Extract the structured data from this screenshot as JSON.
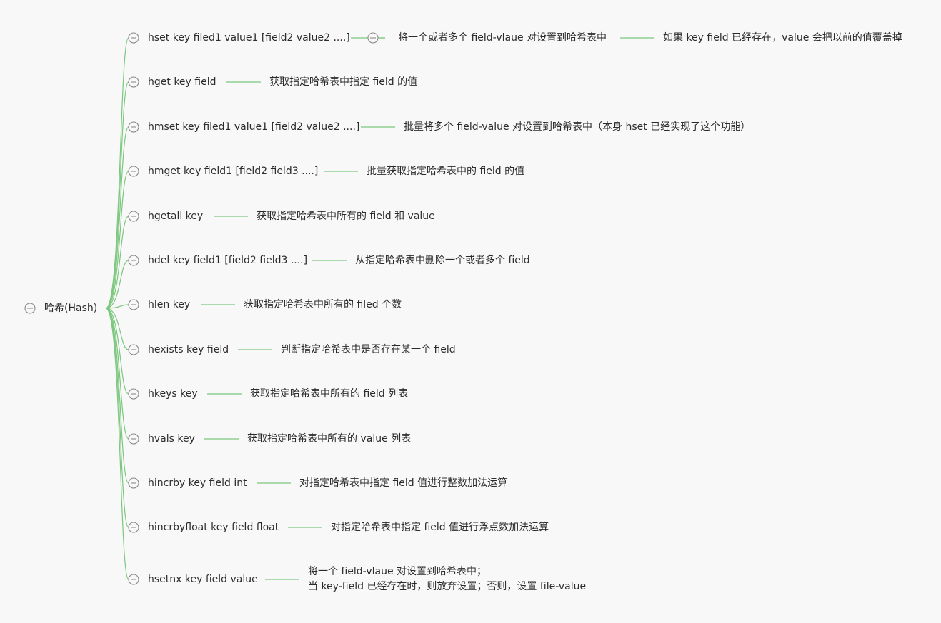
{
  "root": {
    "label": "哈希(Hash)"
  },
  "commands": [
    {
      "cmd": "hset key filed1 value1 [field2 value2 ....]",
      "desc": [
        "将一个或者多个 field-vlaue 对设置到哈希表中"
      ],
      "desc2": "如果 key field 已经存在，value 会把以前的值覆盖掉",
      "desc_collapsible": true
    },
    {
      "cmd": "hget key field",
      "desc": [
        "获取指定哈希表中指定 field 的值"
      ]
    },
    {
      "cmd": "hmset key filed1 value1 [field2 value2 ....]",
      "desc": [
        "批量将多个 field-value 对设置到哈希表中（本身 hset 已经实现了这个功能）"
      ]
    },
    {
      "cmd": "hmget key field1 [field2 field3 ....]",
      "desc": [
        "批量获取指定哈希表中的 field 的值"
      ]
    },
    {
      "cmd": "hgetall key",
      "desc": [
        "获取指定哈希表中所有的 field 和 value"
      ]
    },
    {
      "cmd": "hdel key field1 [field2 field3 ....]",
      "desc": [
        "从指定哈希表中删除一个或者多个 field"
      ]
    },
    {
      "cmd": "hlen key",
      "desc": [
        "获取指定哈希表中所有的 filed 个数"
      ]
    },
    {
      "cmd": "hexists key field",
      "desc": [
        "判断指定哈希表中是否存在某一个 field"
      ]
    },
    {
      "cmd": "hkeys key",
      "desc": [
        "获取指定哈希表中所有的 field 列表"
      ]
    },
    {
      "cmd": "hvals key",
      "desc": [
        "获取指定哈希表中所有的 value 列表"
      ]
    },
    {
      "cmd": "hincrby key field int",
      "desc": [
        "对指定哈希表中指定 field 值进行整数加法运算"
      ]
    },
    {
      "cmd": "hincrbyfloat key field float",
      "desc": [
        "对指定哈希表中指定 field 值进行浮点数加法运算"
      ]
    },
    {
      "cmd": "hsetnx key field value",
      "desc": [
        "将一个 field-vlaue 对设置到哈希表中；",
        "当 key-field 已经存在时，则放弃设置；否则，设置 file-value"
      ]
    }
  ]
}
